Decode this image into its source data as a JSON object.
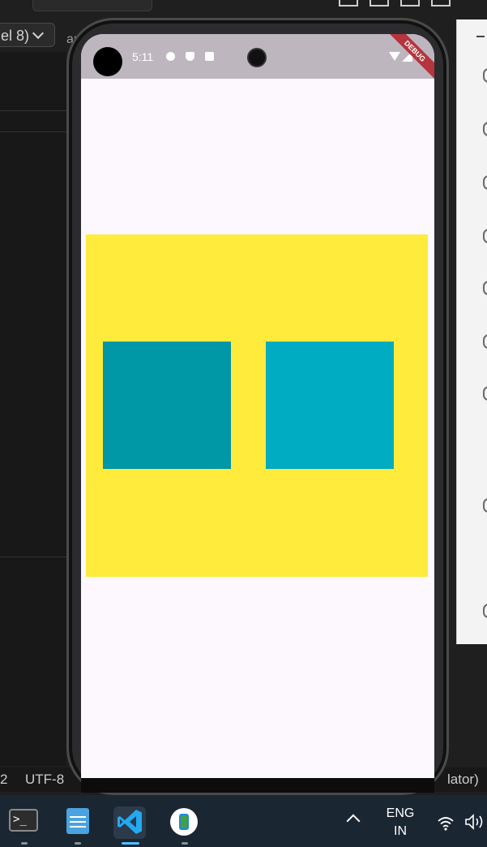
{
  "ide": {
    "device_selector": "el 8)",
    "partial_label": "ar",
    "status_left_number": "2",
    "encoding": "UTF-8",
    "status_right": "lator)"
  },
  "emulator": {
    "status_bar": {
      "time": "5:11",
      "debug_banner": "DEBUG"
    },
    "app": {
      "background_color": "#fdf7fe",
      "container_color": "#ffeb3b",
      "left_box_color": "#0097a7",
      "right_box_color": "#00acc1"
    }
  },
  "taskbar": {
    "apps": [
      "terminal-icon",
      "notepad-icon",
      "vscode-icon",
      "android-emulator-icon"
    ],
    "active_app": "vscode-icon",
    "language_line1": "ENG",
    "language_line2": "IN"
  }
}
